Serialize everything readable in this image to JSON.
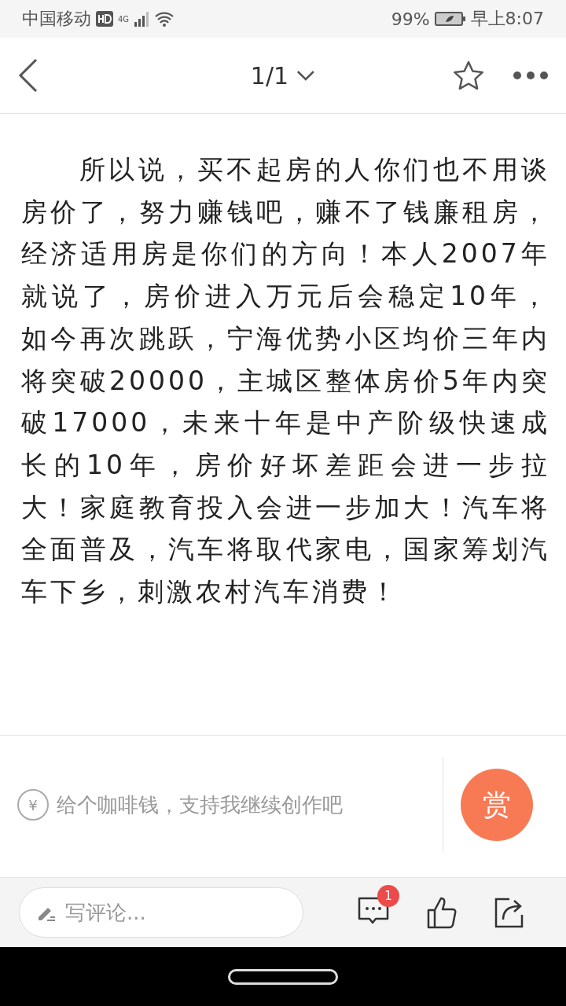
{
  "status_bar": {
    "carrier": "中国移动",
    "network": "4G",
    "battery": "99%",
    "time": "早上8:07"
  },
  "header": {
    "page_indicator": "1/1"
  },
  "article": {
    "paragraph": "所以说，买不起房的人你们也不用谈房价了，努力赚钱吧，赚不了钱廉租房，经济适用房是你们的方向！本人2007年就说了，房价进入万元后会稳定10年，如今再次跳跃，宁海优势小区均价三年内将突破20000，主城区整体房价5年内突破17000，未来十年是中产阶级快速成长的10年，房价好坏差距会进一步拉大！家庭教育投入会进一步加大！汽车将全面普及，汽车将取代家电，国家筹划汽车下乡，刺激农村汽车消费！"
  },
  "reward": {
    "currency_symbol": "¥",
    "text": "给个咖啡钱，支持我继续创作吧",
    "button": "赏"
  },
  "bottom_bar": {
    "comment_placeholder": "写评论...",
    "comment_count": "1"
  }
}
